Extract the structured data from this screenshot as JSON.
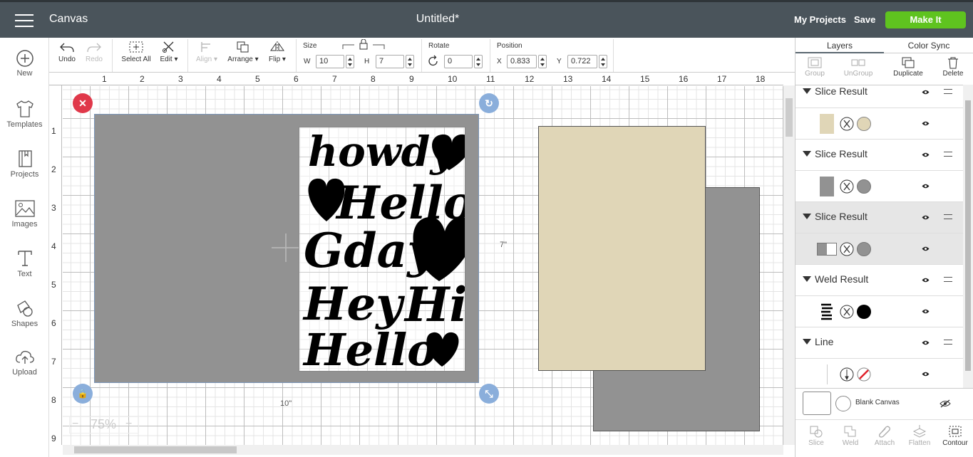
{
  "header": {
    "app_title": "Canvas",
    "document_title": "Untitled*",
    "my_projects": "My Projects",
    "save": "Save",
    "make_it": "Make It"
  },
  "left_toolbar": [
    {
      "label": "New",
      "icon": "plus-circle-icon"
    },
    {
      "label": "Templates",
      "icon": "tshirt-icon"
    },
    {
      "label": "Projects",
      "icon": "book-icon"
    },
    {
      "label": "Images",
      "icon": "image-icon"
    },
    {
      "label": "Text",
      "icon": "text-icon"
    },
    {
      "label": "Shapes",
      "icon": "shapes-icon"
    },
    {
      "label": "Upload",
      "icon": "cloud-upload-icon"
    }
  ],
  "edit_toolbar": {
    "undo": "Undo",
    "redo": "Redo",
    "select_all": "Select All",
    "edit": "Edit",
    "align": "Align",
    "arrange": "Arrange",
    "flip": "Flip",
    "size_label": "Size",
    "w_label": "W",
    "w_value": "10",
    "h_label": "H",
    "h_value": "7",
    "rotate_label": "Rotate",
    "rotate_value": "0",
    "position_label": "Position",
    "x_label": "X",
    "x_value": "0.833",
    "y_label": "Y",
    "y_value": "0.722"
  },
  "canvas": {
    "ruler_top": [
      "1",
      "2",
      "3",
      "4",
      "5",
      "6",
      "7",
      "8",
      "9",
      "10",
      "11",
      "12",
      "13",
      "14",
      "15",
      "16",
      "17",
      "18"
    ],
    "ruler_left": [
      "1",
      "2",
      "3",
      "4",
      "5",
      "6",
      "7",
      "8",
      "9"
    ],
    "width_label": "10\"",
    "height_label": "7\"",
    "zoom_level": "75%",
    "zoom_minus": "−",
    "zoom_plus": "+",
    "design_words": [
      "howdy",
      "Hello",
      "Gday",
      "Hey",
      "Hi",
      "Hello"
    ],
    "colors": {
      "gray": "#929292",
      "tan": "#e0d6b7",
      "black": "#000000",
      "delete_handle": "#e0384a",
      "handle_blue": "#8aaedb"
    }
  },
  "right_panel": {
    "tabs": {
      "layers": "Layers",
      "color_sync": "Color Sync"
    },
    "actions": {
      "group": "Group",
      "ungroup": "UnGroup",
      "duplicate": "Duplicate",
      "delete": "Delete"
    },
    "layers": [
      {
        "name": "Slice Result",
        "color": "#e0d6b7"
      },
      {
        "name": "Slice Result",
        "color": "#929292"
      },
      {
        "name": "Slice Result",
        "color": "#929292"
      },
      {
        "name": "Weld Result",
        "color": "#000000"
      },
      {
        "name": "Line",
        "color": "#ffffff"
      }
    ],
    "blank_canvas": "Blank Canvas",
    "bottom_actions": {
      "slice": "Slice",
      "weld": "Weld",
      "attach": "Attach",
      "flatten": "Flatten",
      "contour": "Contour"
    }
  }
}
